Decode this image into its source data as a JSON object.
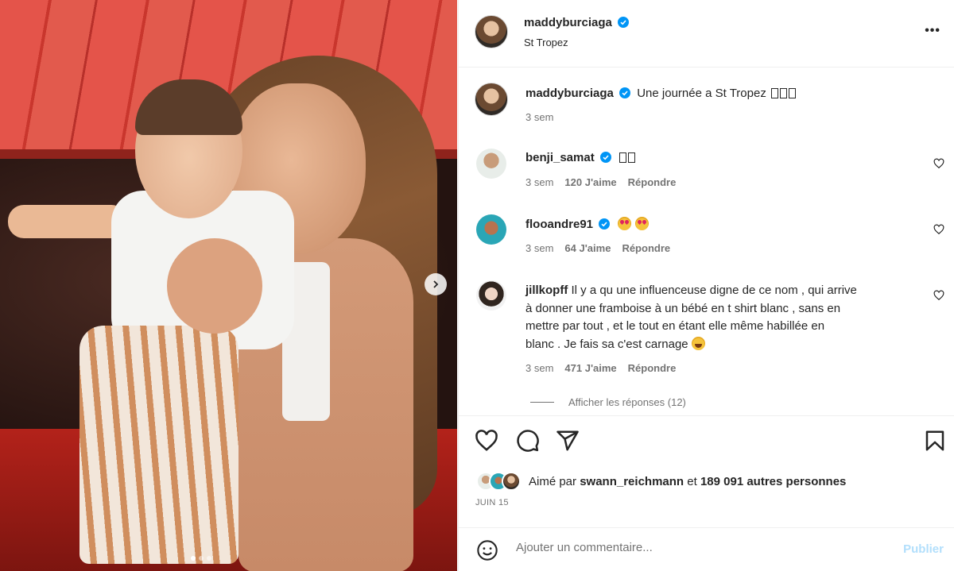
{
  "post": {
    "username": "maddyburciaga",
    "location": "St Tropez",
    "caption": "Une journée a St Tropez",
    "caption_time": "3 sem",
    "photo_alt": "",
    "more_label": "•••"
  },
  "comments": [
    {
      "username": "benji_samat",
      "verified": true,
      "text": "",
      "time": "3 sem",
      "likes": "120 J'aime",
      "reply": "Répondre"
    },
    {
      "username": "flooandre91",
      "verified": true,
      "text": "",
      "time": "3 sem",
      "likes": "64 J'aime",
      "reply": "Répondre"
    },
    {
      "username": "jillkopff",
      "verified": false,
      "text_line1": "Il y a qu une influenceuse digne de ce nom , qui arrive",
      "text_line2": "à donner une framboise à un bébé en t shirt blanc , sans en",
      "text_line3": "mettre par tout , et le tout en étant elle même habillée en",
      "text_line4": "blanc . Je fais sa c'est carnage",
      "time": "3 sem",
      "likes": "471 J'aime",
      "reply": "Répondre",
      "view_replies": "Afficher les réponses (12)"
    }
  ],
  "likes_row": {
    "prefix": "Aimé par",
    "liker": "swann_reichmann",
    "connector": "et",
    "others": "189 091 autres personnes"
  },
  "date": "JUIN 15",
  "comment_box": {
    "placeholder": "Ajouter un commentaire...",
    "publish": "Publier"
  },
  "colors": {
    "verified": "#0095f6",
    "text": "#262626",
    "muted": "#737373",
    "publish_disabled": "#b2dffc"
  },
  "icons": [
    "verified-icon",
    "more-icon",
    "heart-icon",
    "comment-icon",
    "share-icon",
    "bookmark-icon",
    "emoji-icon",
    "chevron-right-icon"
  ]
}
